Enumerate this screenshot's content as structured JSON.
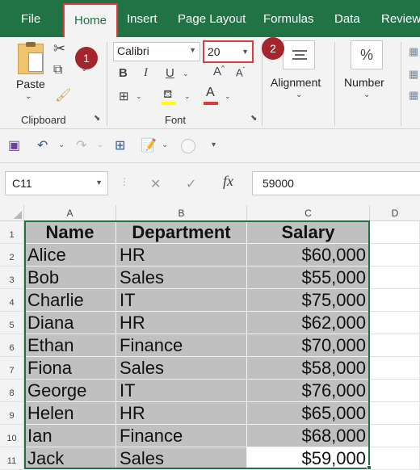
{
  "menu": {
    "tabs": [
      "File",
      "Home",
      "Insert",
      "Page Layout",
      "Formulas",
      "Data",
      "Review"
    ],
    "active_tab": "Home"
  },
  "ribbon": {
    "clipboard": {
      "paste_label": "Paste",
      "group_label": "Clipboard"
    },
    "font": {
      "font_name": "Calibri",
      "font_size": "20",
      "group_label": "Font"
    },
    "alignment": {
      "label": "Alignment"
    },
    "number": {
      "label": "Number",
      "symbol": "%"
    }
  },
  "annotations": [
    "1",
    "2"
  ],
  "formula_bar": {
    "name_box": "C11",
    "fx_label": "fx",
    "value": "59000"
  },
  "sheet": {
    "columns": [
      "A",
      "B",
      "C",
      "D"
    ],
    "rows": [
      "1",
      "2",
      "3",
      "4",
      "5",
      "6",
      "7",
      "8",
      "9",
      "10",
      "11"
    ],
    "header": [
      "Name",
      "Department",
      "Salary"
    ],
    "data": [
      [
        "Alice",
        "HR",
        "$60,000"
      ],
      [
        "Bob",
        "Sales",
        "$55,000"
      ],
      [
        "Charlie",
        "IT",
        "$75,000"
      ],
      [
        "Diana",
        "HR",
        "$62,000"
      ],
      [
        "Ethan",
        "Finance",
        "$70,000"
      ],
      [
        "Fiona",
        "Sales",
        "$58,000"
      ],
      [
        "George",
        "IT",
        "$76,000"
      ],
      [
        "Helen",
        "HR",
        "$65,000"
      ],
      [
        "Ian",
        "Finance",
        "$68,000"
      ],
      [
        "Jack",
        "Sales",
        "$59,000"
      ]
    ],
    "selection_color": "#217346",
    "fill_color": "#c0c0c0"
  },
  "colors": {
    "accent": "#217346",
    "highlight_border": "#e03b3b",
    "badge": "#a4262c"
  }
}
